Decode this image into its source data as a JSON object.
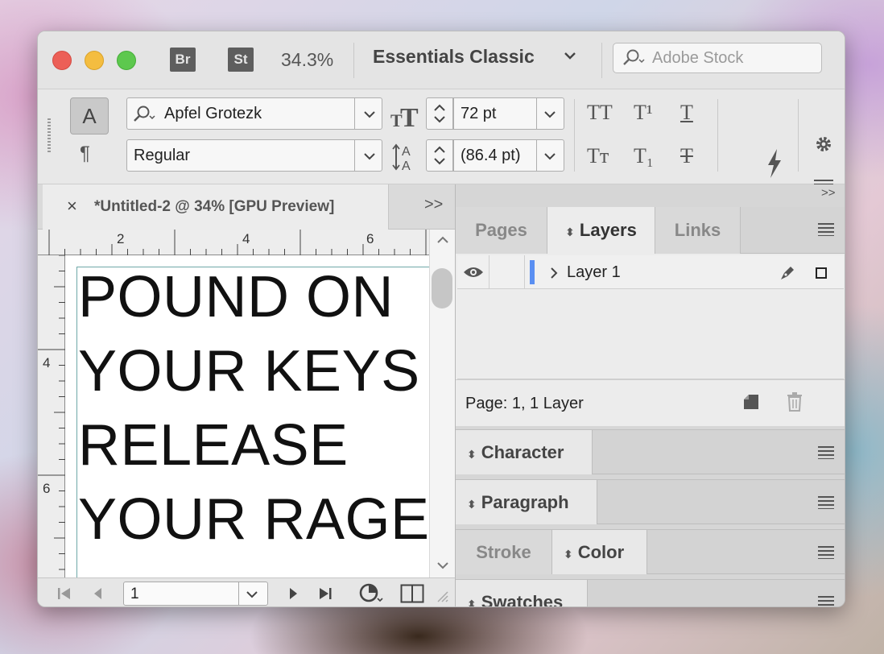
{
  "titlebar": {
    "bridge_label": "Br",
    "stock_label": "St",
    "zoom": "34.3%",
    "workspace": "Essentials Classic",
    "search_placeholder": "Adobe Stock"
  },
  "controlbar": {
    "font_family": "Apfel Grotezk",
    "font_style": "Regular",
    "font_size": "72 pt",
    "leading": "(86.4 pt)",
    "char_mode_label": "A",
    "para_mode_label": "¶",
    "fmt_allcaps": "TT",
    "fmt_super": "T¹",
    "fmt_underline": "T",
    "fmt_smallcaps": "Tт",
    "fmt_sub": "T₁",
    "fmt_strike": "T"
  },
  "document": {
    "tab_title": "*Untitled-2 @ 34% [GPU Preview]",
    "close_label": "×",
    "more_label": ">>",
    "ruler_h": [
      "2",
      "4",
      "6"
    ],
    "ruler_v": [
      "4",
      "6"
    ],
    "headline_lines": [
      "POUND ON",
      "YOUR KEYS",
      "RELEASE",
      "YOUR RAGE"
    ]
  },
  "statusbar": {
    "page_number": "1"
  },
  "panels": {
    "collapse_label": ">>",
    "top_tabs": [
      "Pages",
      "Layers",
      "Links"
    ],
    "layer_name": "Layer 1",
    "layers_footer": "Page: 1, 1 Layer",
    "character": "Character",
    "paragraph": "Paragraph",
    "stroke": "Stroke",
    "color": "Color",
    "swatches": "Swatches"
  },
  "colors": {
    "close": "#ec5f57",
    "minimize": "#f4bd40",
    "maximize": "#5dc84e",
    "layer_chip": "#5a8ff2"
  }
}
